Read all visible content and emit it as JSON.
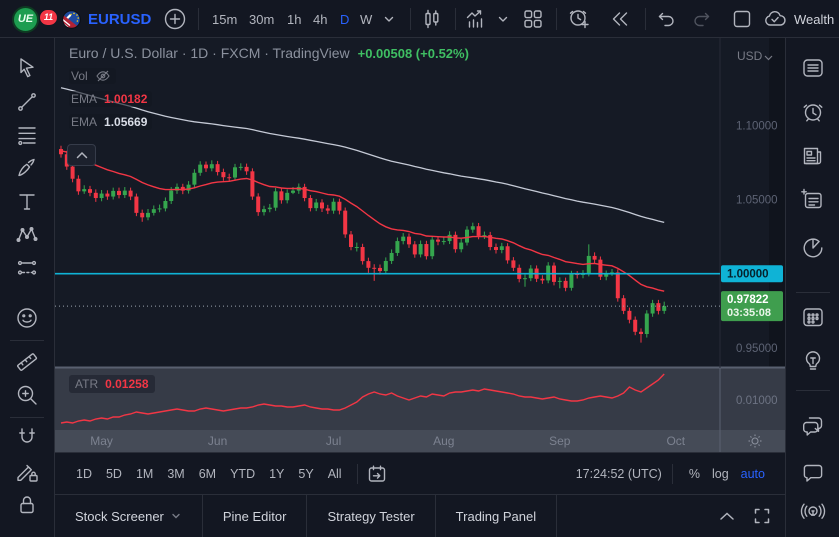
{
  "topbar": {
    "notification_count": "11",
    "logo_text": "UE",
    "symbol": "EURUSD",
    "timeframes": [
      "15m",
      "30m",
      "1h",
      "4h",
      "D",
      "W"
    ],
    "active_timeframe": "D",
    "wealth_label": "Wealth"
  },
  "legend": {
    "title": "Euro / U.S. Dollar · 1D · FXCM · TradingView",
    "change": "+0.00508 (+0.52%)",
    "vol_label": "Vol"
  },
  "range_toolbar": {
    "ranges": [
      "1D",
      "5D",
      "1M",
      "3M",
      "6M",
      "YTD",
      "1Y",
      "5Y",
      "All"
    ],
    "clock": "17:24:52 (UTC)",
    "percent": "%",
    "log": "log",
    "auto": "auto"
  },
  "bottom_tabs": {
    "tabs": [
      "Stock Screener",
      "Pine Editor",
      "Strategy Tester",
      "Trading Panel"
    ]
  },
  "chart_data": {
    "type": "candlestick",
    "symbol": "EURUSD",
    "up_color": "#35a64e",
    "down_color": "#f23645",
    "y_map": {
      "price_at_top": 1.1588,
      "price_at_bottom": 0.9365
    },
    "y_ticks": [
      {
        "label": "1.10000",
        "price": 1.1
      },
      {
        "label": "1.05000",
        "price": 1.05
      },
      {
        "label": "0.95000",
        "price": 0.95
      }
    ],
    "x_ticks": [
      {
        "label": "May",
        "index": 7
      },
      {
        "label": "Jun",
        "index": 27
      },
      {
        "label": "Jul",
        "index": 47
      },
      {
        "label": "Aug",
        "index": 66
      },
      {
        "label": "Sep",
        "index": 86
      },
      {
        "label": "Oct",
        "index": 106
      }
    ],
    "currency_label": "USD",
    "parity_line": {
      "price": 1.0,
      "label": "1.00000",
      "color": "#0fb3d6"
    },
    "last": {
      "price": 0.97822,
      "label": "0.97822",
      "countdown": "03:35:08",
      "color": "#3f9e4e"
    },
    "ema_fast": {
      "label": "EMA",
      "value": "1.00182",
      "color": "#f23645",
      "period": 24,
      "seed": 1.083
    },
    "ema_slow": {
      "label": "EMA",
      "value": "1.05669",
      "color": "#c5cad6",
      "period": 120,
      "seed": 1.126
    },
    "atr_pane": {
      "label": "ATR",
      "value": "0.01258",
      "color": "#f23645",
      "tick_label": "0.01000",
      "tick_value": 0.01,
      "scale": {
        "value_at_top": 0.0131,
        "value_at_bottom": 0.0071
      },
      "values": [
        0.0077,
        0.0078,
        0.0077,
        0.0079,
        0.008,
        0.0079,
        0.0081,
        0.0082,
        0.0081,
        0.0083,
        0.0083,
        0.0085,
        0.0086,
        0.0088,
        0.0087,
        0.0086,
        0.0087,
        0.0088,
        0.0089,
        0.009,
        0.0091,
        0.009,
        0.0089,
        0.0089,
        0.0091,
        0.0092,
        0.0091,
        0.009,
        0.0089,
        0.009,
        0.0091,
        0.0092,
        0.0092,
        0.0093,
        0.0095,
        0.0096,
        0.0095,
        0.0094,
        0.0094,
        0.0093,
        0.0093,
        0.0094,
        0.0095,
        0.0093,
        0.0092,
        0.0091,
        0.0091,
        0.009,
        0.009,
        0.0092,
        0.0095,
        0.0098,
        0.0103,
        0.0106,
        0.0108,
        0.0106,
        0.0105,
        0.0107,
        0.0104,
        0.0102,
        0.01,
        0.0102,
        0.0104,
        0.0103,
        0.0106,
        0.0105,
        0.0104,
        0.0107,
        0.0108,
        0.0108,
        0.0109,
        0.011,
        0.0109,
        0.0111,
        0.011,
        0.0109,
        0.0108,
        0.0107,
        0.0106,
        0.0104,
        0.0103,
        0.0103,
        0.0102,
        0.0101,
        0.0102,
        0.0103,
        0.0101,
        0.01,
        0.0099,
        0.0099,
        0.01,
        0.0102,
        0.0103,
        0.0104,
        0.0103,
        0.0102,
        0.0104,
        0.0107,
        0.0113,
        0.011,
        0.0108,
        0.0112,
        0.0116,
        0.012,
        0.0126
      ]
    },
    "candles": [
      [
        1.084,
        1.0862,
        1.0782,
        1.0805
      ],
      [
        1.0805,
        1.0828,
        1.07,
        1.0722
      ],
      [
        1.0722,
        1.0742,
        1.0616,
        1.064
      ],
      [
        1.064,
        1.0663,
        1.0532,
        1.0555
      ],
      [
        1.0555,
        1.0596,
        1.0538,
        1.057
      ],
      [
        1.057,
        1.0592,
        1.0522,
        1.0545
      ],
      [
        1.0545,
        1.0568,
        1.0484,
        1.051
      ],
      [
        1.051,
        1.0564,
        1.0488,
        1.054
      ],
      [
        1.054,
        1.0562,
        1.0498,
        1.052
      ],
      [
        1.052,
        1.058,
        1.05,
        1.0558
      ],
      [
        1.0558,
        1.058,
        1.0508,
        1.053
      ],
      [
        1.053,
        1.0584,
        1.051,
        1.056
      ],
      [
        1.056,
        1.058,
        1.0496,
        1.052
      ],
      [
        1.052,
        1.054,
        1.0388,
        1.041
      ],
      [
        1.041,
        1.0432,
        1.035,
        1.038
      ],
      [
        1.038,
        1.0436,
        1.036,
        1.041
      ],
      [
        1.041,
        1.046,
        1.0392,
        1.0435
      ],
      [
        1.0435,
        1.0466,
        1.0414,
        1.044
      ],
      [
        1.044,
        1.0514,
        1.042,
        1.049
      ],
      [
        1.049,
        1.0584,
        1.047,
        1.056
      ],
      [
        1.056,
        1.0608,
        1.0538,
        1.0585
      ],
      [
        1.0585,
        1.0606,
        1.0536,
        1.056
      ],
      [
        1.056,
        1.0624,
        1.054,
        1.06
      ],
      [
        1.06,
        1.0704,
        1.058,
        1.068
      ],
      [
        1.068,
        1.0758,
        1.066,
        1.0735
      ],
      [
        1.0735,
        1.0756,
        1.0686,
        1.071
      ],
      [
        1.071,
        1.0764,
        1.069,
        1.0738
      ],
      [
        1.0738,
        1.076,
        1.0662,
        1.0685
      ],
      [
        1.0685,
        1.0708,
        1.0626,
        1.065
      ],
      [
        1.065,
        1.0674,
        1.0624,
        1.0648
      ],
      [
        1.0648,
        1.074,
        1.0628,
        1.0717
      ],
      [
        1.0717,
        1.0744,
        1.0696,
        1.072
      ],
      [
        1.072,
        1.0742,
        1.0666,
        1.069
      ],
      [
        1.069,
        1.071,
        1.0498,
        1.052
      ],
      [
        1.052,
        1.0542,
        1.039,
        1.0415
      ],
      [
        1.0415,
        1.0458,
        1.0392,
        1.0435
      ],
      [
        1.0435,
        1.047,
        1.0414,
        1.0445
      ],
      [
        1.0445,
        1.0578,
        1.0424,
        1.0555
      ],
      [
        1.0555,
        1.0576,
        1.0472,
        1.0495
      ],
      [
        1.0495,
        1.0568,
        1.0474,
        1.0545
      ],
      [
        1.0545,
        1.0584,
        1.0536,
        1.056
      ],
      [
        1.056,
        1.0608,
        1.0538,
        1.0585
      ],
      [
        1.0585,
        1.0606,
        1.0488,
        1.051
      ],
      [
        1.051,
        1.053,
        1.042,
        1.0442
      ],
      [
        1.0442,
        1.0504,
        1.0422,
        1.048
      ],
      [
        1.048,
        1.0502,
        1.0416,
        1.044
      ],
      [
        1.044,
        1.0464,
        1.0402,
        1.0425
      ],
      [
        1.0425,
        1.0508,
        1.0404,
        1.0485
      ],
      [
        1.0485,
        1.0506,
        1.04,
        1.0425
      ],
      [
        1.0425,
        1.0446,
        1.0242,
        1.0265
      ],
      [
        1.0265,
        1.0288,
        1.0158,
        1.018
      ],
      [
        1.018,
        1.021,
        1.015,
        1.018
      ],
      [
        1.018,
        1.0202,
        1.0062,
        1.0085
      ],
      [
        1.0085,
        1.0108,
        1.0006,
        1.004
      ],
      [
        1.004,
        1.0064,
        0.9952,
        1.0039
      ],
      [
        1.0039,
        1.0062,
        0.9994,
        1.0018
      ],
      [
        1.0018,
        1.011,
        0.9998,
        1.0086
      ],
      [
        1.0086,
        1.0164,
        1.0066,
        1.014
      ],
      [
        1.014,
        1.0244,
        1.012,
        1.022
      ],
      [
        1.022,
        1.0274,
        1.0198,
        1.025
      ],
      [
        1.025,
        1.0272,
        1.0174,
        1.0198
      ],
      [
        1.0198,
        1.022,
        1.0108,
        1.013
      ],
      [
        1.013,
        1.0224,
        1.011,
        1.02
      ],
      [
        1.02,
        1.0222,
        1.0096,
        1.0118
      ],
      [
        1.0118,
        1.0254,
        1.0098,
        1.023
      ],
      [
        1.023,
        1.0254,
        1.0192,
        1.0216
      ],
      [
        1.0216,
        1.0246,
        1.0196,
        1.022
      ],
      [
        1.022,
        1.0286,
        1.02,
        1.0262
      ],
      [
        1.0262,
        1.0284,
        1.0142,
        1.0165
      ],
      [
        1.0165,
        1.0234,
        1.0144,
        1.021
      ],
      [
        1.021,
        1.032,
        1.019,
        1.0297
      ],
      [
        1.0297,
        1.0344,
        1.0276,
        1.032
      ],
      [
        1.032,
        1.0342,
        1.0232,
        1.0255
      ],
      [
        1.0255,
        1.0284,
        1.0234,
        1.026
      ],
      [
        1.026,
        1.0282,
        1.0158,
        1.018
      ],
      [
        1.018,
        1.0204,
        1.0136,
        1.016
      ],
      [
        1.016,
        1.0208,
        1.0138,
        1.0185
      ],
      [
        1.0185,
        1.0206,
        1.0068,
        1.009
      ],
      [
        1.009,
        1.0112,
        1.0018,
        1.004
      ],
      [
        1.004,
        1.0062,
        0.9942,
        0.9965
      ],
      [
        0.9965,
        0.9994,
        0.9912,
        0.997
      ],
      [
        0.997,
        1.0058,
        0.995,
        1.0035
      ],
      [
        1.0035,
        1.0056,
        0.9944,
        0.9966
      ],
      [
        0.9966,
        0.999,
        0.9932,
        0.9955
      ],
      [
        0.9955,
        1.0078,
        0.9936,
        1.0055
      ],
      [
        1.0055,
        1.0076,
        0.9922,
        0.9945
      ],
      [
        0.9945,
        0.9976,
        0.9902,
        0.9952
      ],
      [
        0.9952,
        0.9974,
        0.9882,
        0.9905
      ],
      [
        0.9905,
        1.002,
        0.9886,
        0.9998
      ],
      [
        0.9998,
        1.0018,
        0.9968,
        0.9992
      ],
      [
        0.9992,
        1.0024,
        0.997,
        1.0002
      ],
      [
        1.0002,
        1.0198,
        0.9982,
        1.012
      ],
      [
        1.012,
        1.0144,
        1.0072,
        1.0095
      ],
      [
        1.0095,
        1.0116,
        0.9958,
        0.998
      ],
      [
        0.998,
        1.0022,
        0.9956,
        0.9998
      ],
      [
        0.9998,
        1.0032,
        0.9986,
        1.0009
      ],
      [
        1.0009,
        1.003,
        0.9812,
        0.9835
      ],
      [
        0.9835,
        0.9856,
        0.9728,
        0.975
      ],
      [
        0.975,
        0.9772,
        0.9666,
        0.969
      ],
      [
        0.969,
        0.9712,
        0.9586,
        0.9609
      ],
      [
        0.9609,
        0.9632,
        0.9536,
        0.9594
      ],
      [
        0.9594,
        0.9754,
        0.957,
        0.9732
      ],
      [
        0.9732,
        0.9824,
        0.971,
        0.9802
      ],
      [
        0.9802,
        0.9824,
        0.9726,
        0.975
      ],
      [
        0.975,
        0.9812,
        0.973,
        0.9782
      ]
    ]
  }
}
